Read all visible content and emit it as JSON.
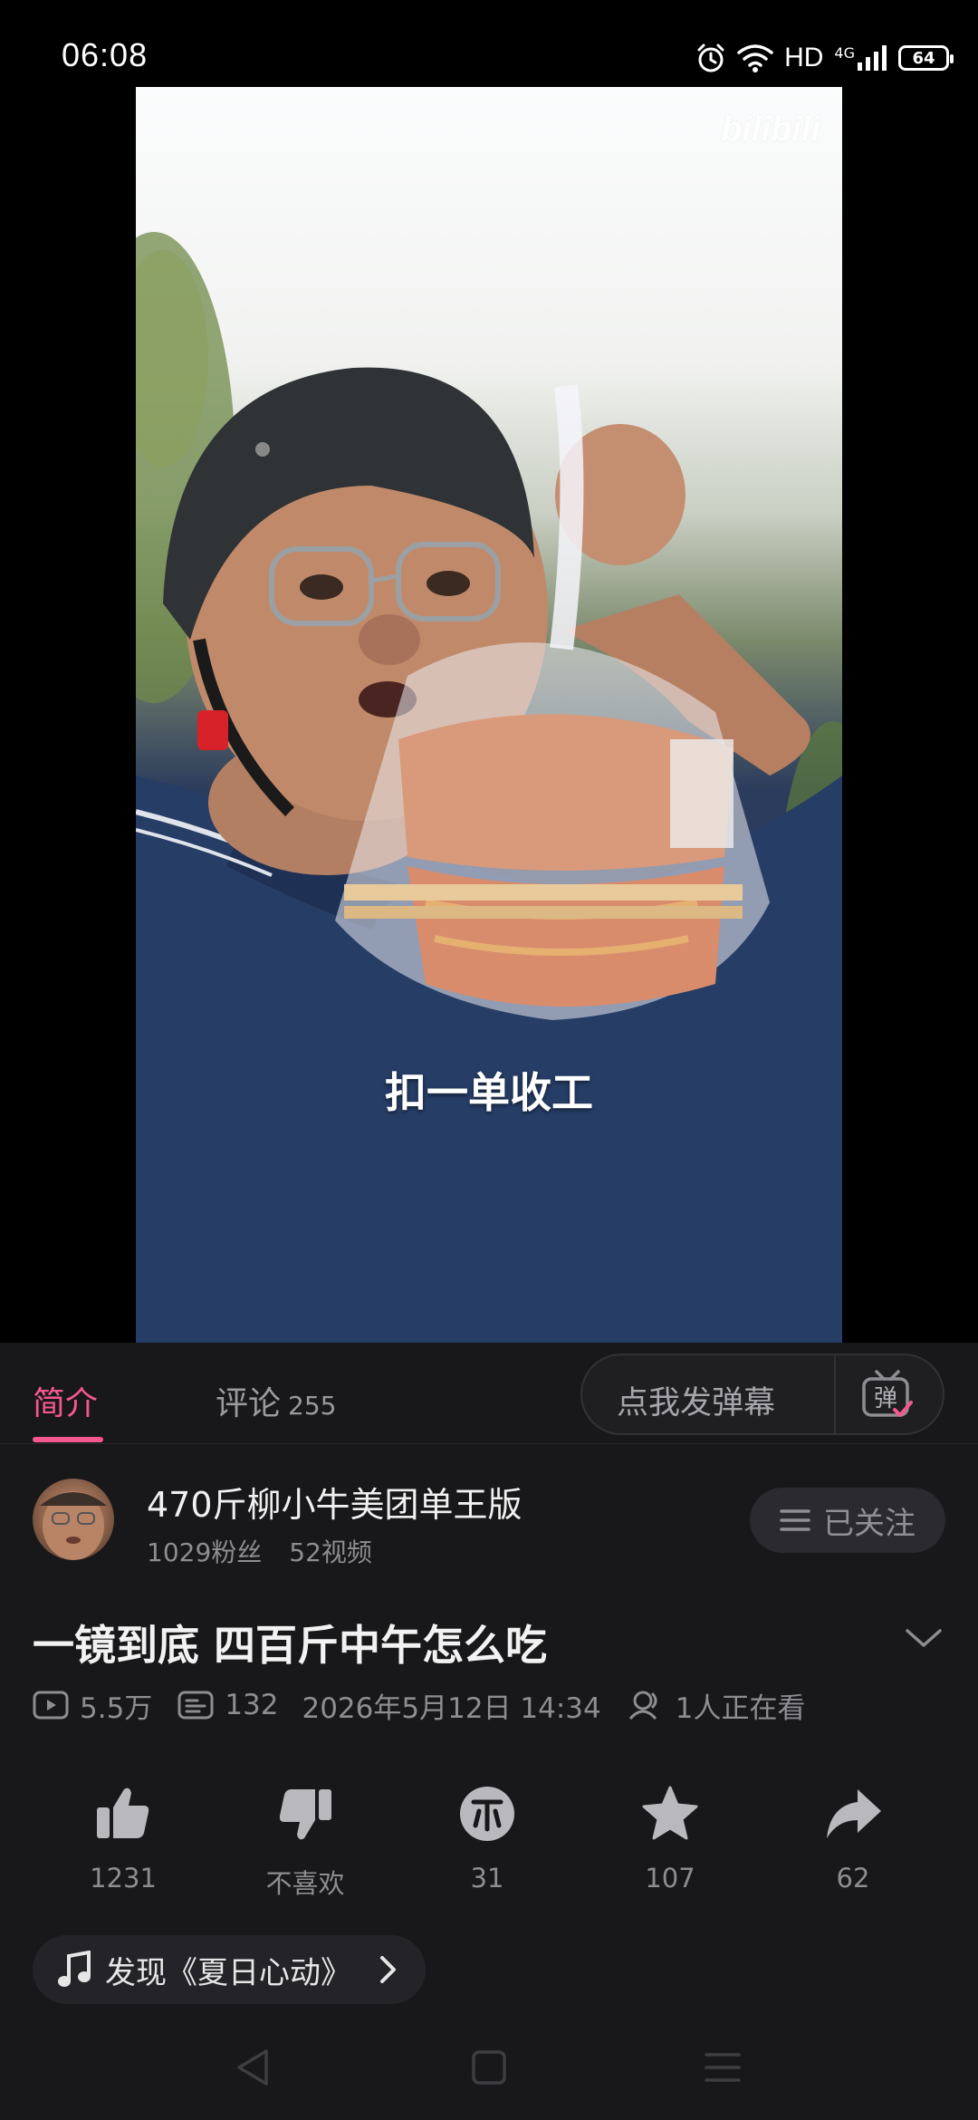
{
  "status_bar": {
    "time": "06:08",
    "network_label": "HD",
    "network_type": "4G",
    "battery": "64"
  },
  "video": {
    "watermark": "bilibili",
    "subtitle": "扣一单收工"
  },
  "tabs": {
    "intro_label": "简介",
    "comments_label": "评论",
    "comments_count": "255"
  },
  "danmaku": {
    "placeholder": "点我发弹幕",
    "toggle_glyph": "弹"
  },
  "uploader": {
    "name": "470斤柳小牛美团单王版",
    "followers": "1029粉丝",
    "videos": "52视频",
    "follow_label": "已关注"
  },
  "video_info": {
    "title": "一镜到底 四百斤中午怎么吃",
    "views": "5.5万",
    "danmaku_count": "132",
    "publish_time": "2026年5月12日 14:34",
    "watching": "1人正在看"
  },
  "actions": {
    "like_count": "1231",
    "dislike_label": "不喜欢",
    "coin_count": "31",
    "favorite_count": "107",
    "share_count": "62"
  },
  "music": {
    "label": "发现《夏日心动》"
  },
  "colors": {
    "accent": "#f5578e",
    "panel_bg": "#18181a",
    "muted_text": "#8d8d92"
  }
}
